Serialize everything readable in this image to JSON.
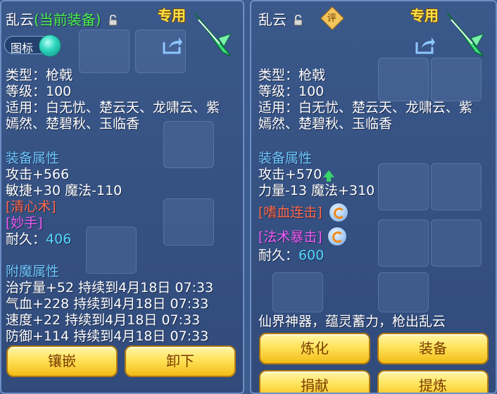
{
  "left": {
    "name": "乱云",
    "name_status": "(当前装备)",
    "exclusive": "专用",
    "tag_label": "图标",
    "stats": [
      "类型：枪戟",
      "等级：100",
      "适用：白无忧、楚云天、龙啸云、紫",
      "嫣然、楚碧秋、玉临香"
    ],
    "equip_title": "装备属性",
    "attack": "攻击+566",
    "agility": "敏捷+30 魔法-110",
    "skill1": "[清心术]",
    "skill2": "[妙手]",
    "durability_label": "耐久：",
    "durability_value": "406",
    "enchant_title": "附魔属性",
    "enchants": [
      "治疗量+52 持续到4月18日 07:33",
      "气血+228 持续到4月18日 07:33",
      "速度+22 持续到4月18日 07:33",
      "防御+114 持续到4月18日 07:33"
    ],
    "btn_inlay": "镶嵌",
    "btn_unequip": "卸下"
  },
  "right": {
    "name": "乱云",
    "eval_badge": "评",
    "exclusive": "专用",
    "stats": [
      "类型：枪戟",
      "等级：100",
      "适用：白无忧、楚云天、龙啸云、紫",
      "嫣然、楚碧秋、玉临香"
    ],
    "equip_title": "装备属性",
    "attack": "攻击+570",
    "strength": "力量-13 魔法+310",
    "skill1": "[嗜血连击]",
    "skill2": "[法术暴击]",
    "durability_label": "耐久：",
    "durability_value": "600",
    "flavor": "仙界神器，蕴灵蓄力，枪出乱云",
    "btn_refine": "炼化",
    "btn_equip": "装备",
    "btn_donate": "捐献",
    "btn_extract": "提炼"
  },
  "colors": {
    "name_status": "#4df04d",
    "section": "#6fc8ff",
    "skill_red": "#ff6a4c",
    "skill_pink": "#ef5cf5",
    "durability": "#55d8ff",
    "button": "#ffe35a",
    "exclusive": "#ffe34a"
  }
}
